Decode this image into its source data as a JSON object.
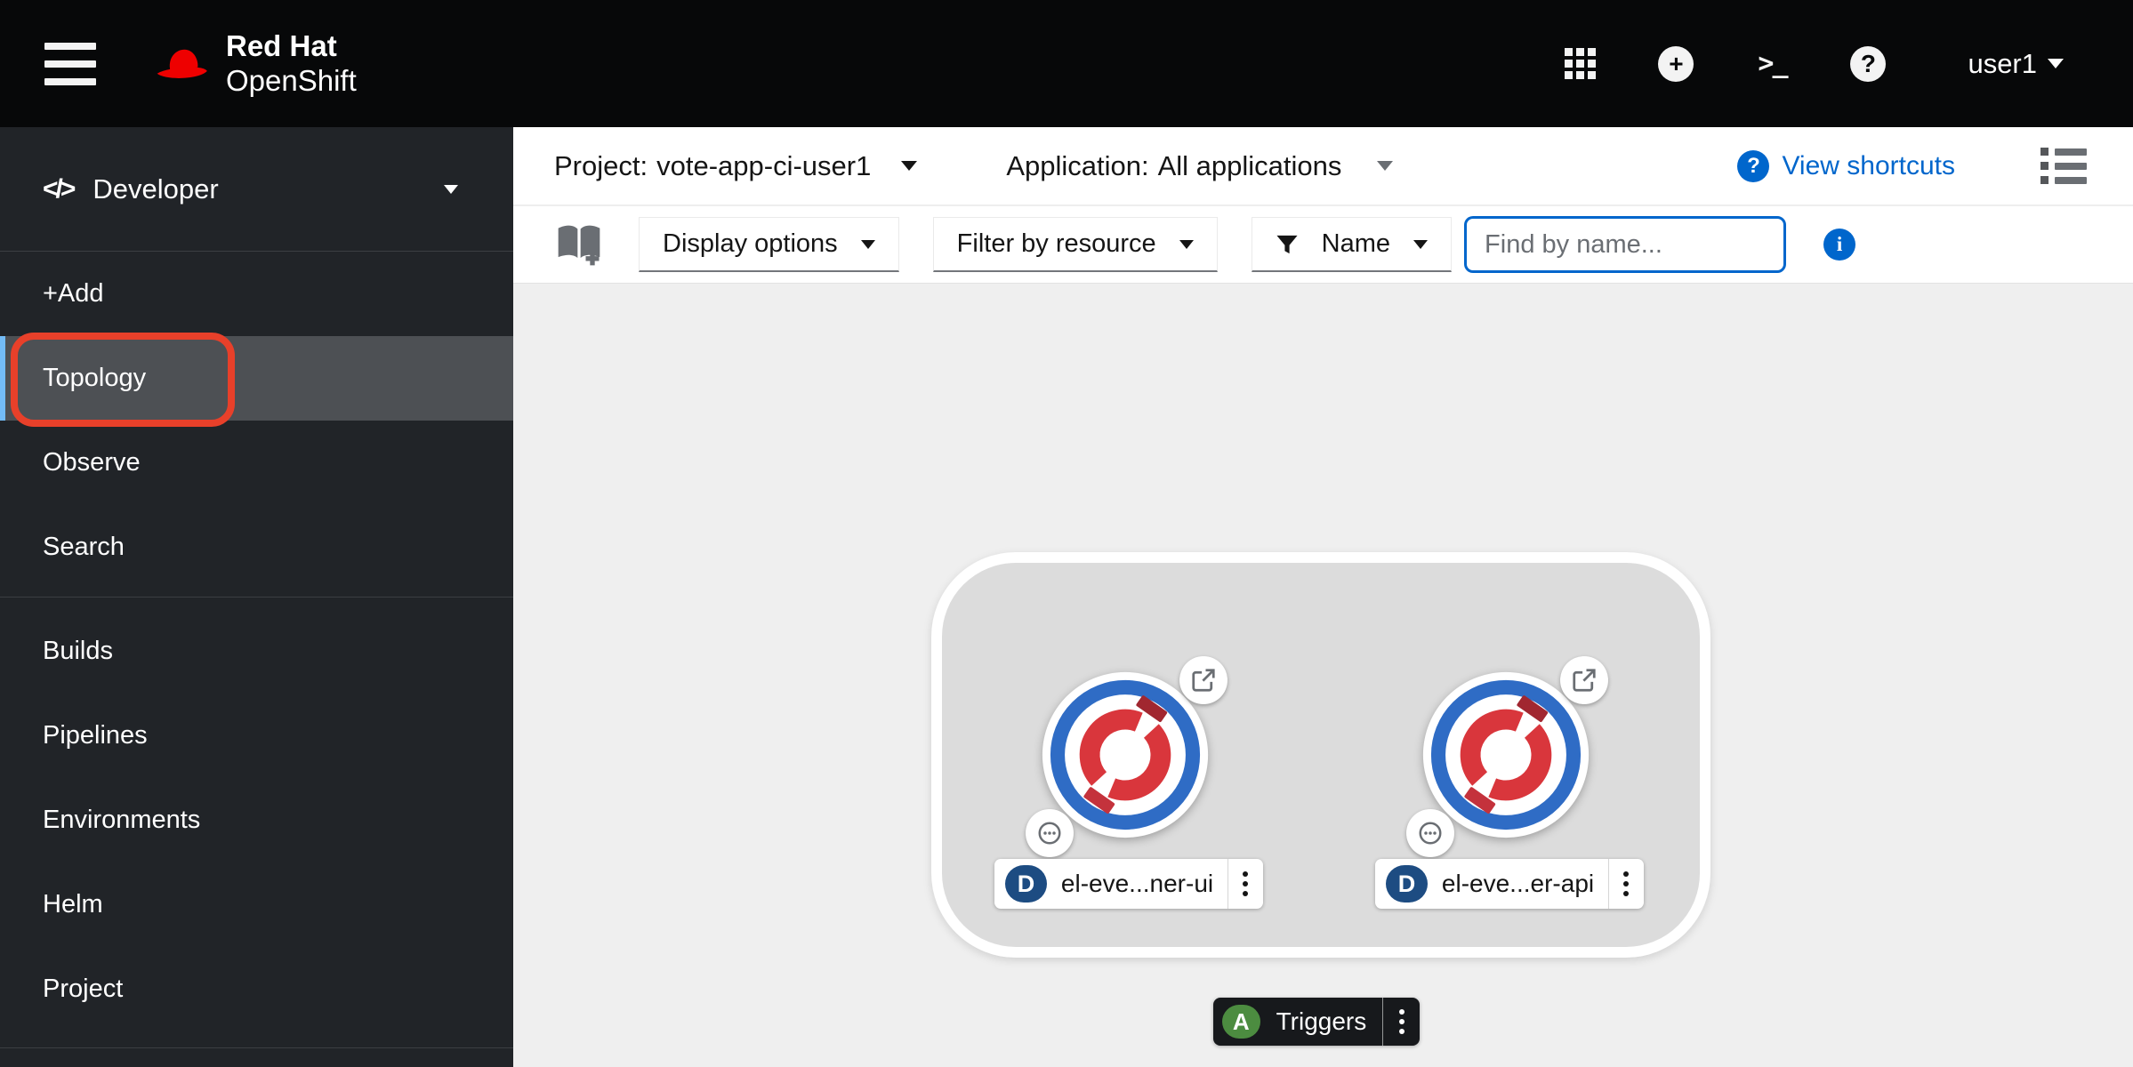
{
  "masthead": {
    "brand_top": "Red Hat",
    "brand_bottom": "OpenShift",
    "username": "user1"
  },
  "sidebar": {
    "perspective": "Developer",
    "group1": [
      {
        "label": "+Add"
      },
      {
        "label": "Topology"
      },
      {
        "label": "Observe"
      },
      {
        "label": "Search"
      }
    ],
    "group2": [
      {
        "label": "Builds"
      },
      {
        "label": "Pipelines"
      },
      {
        "label": "Environments"
      },
      {
        "label": "Helm"
      },
      {
        "label": "Project"
      }
    ]
  },
  "context_bar": {
    "project_prefix": "Project:",
    "project_value": "vote-app-ci-user1",
    "application_prefix": "Application:",
    "application_value": "All applications",
    "shortcuts_label": "View shortcuts"
  },
  "toolbar": {
    "display_options": "Display options",
    "filter_by_resource": "Filter by resource",
    "filter_type": "Name",
    "find_placeholder": "Find by name..."
  },
  "topology": {
    "application_group": {
      "badge": "A",
      "label": "Triggers",
      "nodes": [
        {
          "badge": "D",
          "name": "el-eve...ner-ui"
        },
        {
          "badge": "D",
          "name": "el-eve...er-api"
        }
      ]
    }
  },
  "colors": {
    "accent_blue": "#0066cc",
    "node_ring_blue": "#2f6cc5",
    "logo_red": "#d9363c",
    "badge_navy": "#1d4c82",
    "badge_green": "#4c8c40",
    "annotation_red": "#e8402a",
    "sidebar_bg": "#212428",
    "canvas_bg": "#efefef"
  }
}
